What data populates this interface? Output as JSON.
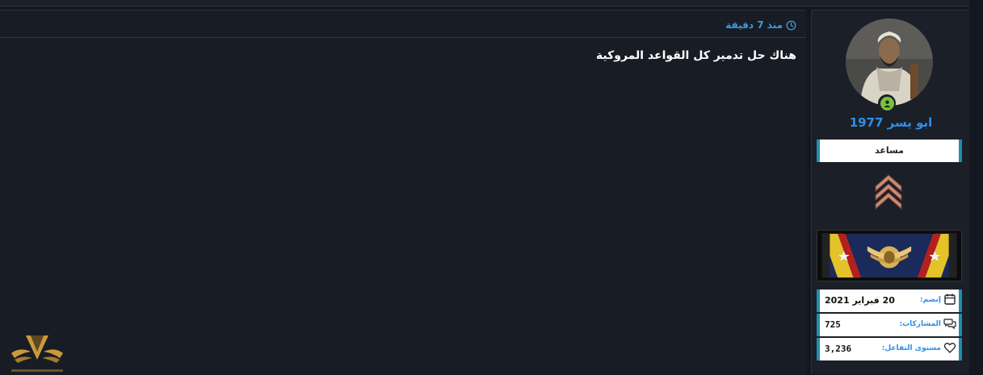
{
  "post": {
    "time_label": "منذ 7 دقيقة",
    "text": "هناك حل تدمير كل القواعد المروكية"
  },
  "user": {
    "username": "ابو يسر 1977",
    "role": "مساعد",
    "online": true
  },
  "stats": {
    "joined_label": "إنضم:",
    "joined_value": "20 فبراير 2021",
    "posts_label": "المشاركات:",
    "posts_value": "725",
    "reaction_label": "مستوى التفاعل:",
    "reaction_value": "3,236"
  },
  "colors": {
    "accent_blue": "#2f8fe8",
    "role_border": "#1f8fb0",
    "online_green": "#7ac23a",
    "background": "#13171f"
  },
  "icons": {
    "time": "clock-icon",
    "joined": "calendar-icon",
    "posts": "comments-icon",
    "reaction": "heart-icon",
    "online": "user-online-icon"
  }
}
